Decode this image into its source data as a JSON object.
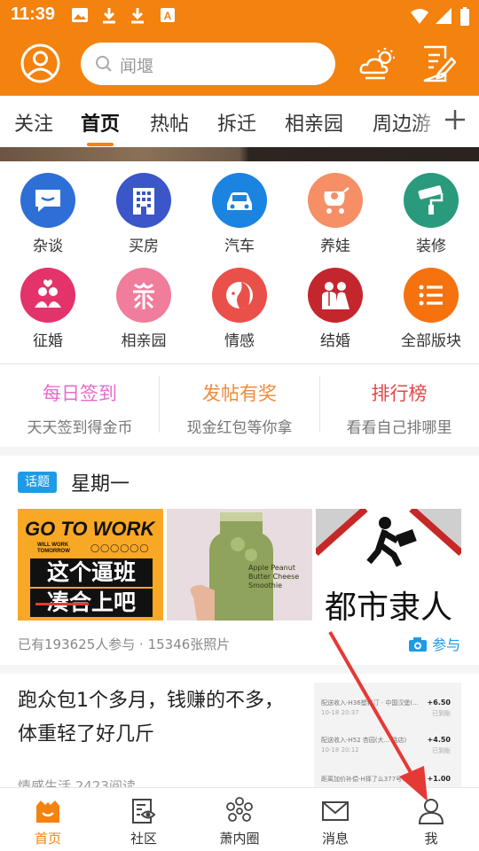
{
  "status_bar": {
    "time": "11:39"
  },
  "header": {
    "search_placeholder": "闻堰",
    "icons": [
      "user-icon",
      "search-icon",
      "weather-icon",
      "edit-icon"
    ]
  },
  "tabs": {
    "items": [
      "关注",
      "首页",
      "热帖",
      "拆迁",
      "相亲园",
      "周边游"
    ],
    "active": "首页"
  },
  "categories": [
    {
      "label": "杂谈",
      "icon": "chat-icon",
      "color": "#2D6FD6"
    },
    {
      "label": "买房",
      "icon": "building-icon",
      "color": "#3B56C9"
    },
    {
      "label": "汽车",
      "icon": "car-icon",
      "color": "#1A84E0"
    },
    {
      "label": "养娃",
      "icon": "stroller-icon",
      "color": "#F68F66"
    },
    {
      "label": "装修",
      "icon": "paint-roller-icon",
      "color": "#2A9A7D"
    },
    {
      "label": "征婚",
      "icon": "couple-icon",
      "color": "#E4336A"
    },
    {
      "label": "相亲园",
      "icon": "marriage-icon",
      "color": "#F07D9B"
    },
    {
      "label": "情感",
      "icon": "face-icon",
      "color": "#E9504A"
    },
    {
      "label": "结婚",
      "icon": "wedding-icon",
      "color": "#C4262E"
    },
    {
      "label": "全部版块",
      "icon": "list-icon",
      "color": "#F6720F"
    }
  ],
  "promos": [
    {
      "title": "每日签到",
      "subtitle": "天天签到得金币",
      "color": "#E86BCB"
    },
    {
      "title": "发帖有奖",
      "subtitle": "现金红包等你拿",
      "color": "#F08A3A"
    },
    {
      "title": "排行榜",
      "subtitle": "看看自己排哪里",
      "color": "#E6454A"
    }
  ],
  "topic": {
    "tag": "话题",
    "title": "星期一",
    "images": [
      {
        "heading": "GO TO WORK",
        "sub": "WILL WORK TOMORROW",
        "line1": "这个逼班",
        "line2": "凑合上吧"
      },
      {
        "bottle_text": "Apple Peanut Butter Cheese Smoothie"
      },
      {
        "caption": "都市隶人"
      }
    ],
    "meta": "已有193625人参与 · 15346张照片",
    "join_label": "参与"
  },
  "article": {
    "title": "跑众包1个多月，钱赚的不多，体重轻了好几斤",
    "meta": "情感生活 2423阅读",
    "thumb_rows": [
      {
        "text": "配送收入-H36塑料汀 · 中国汉堡(...",
        "date": "10-18 20:37",
        "amount": "+6.50",
        "status": "已到账"
      },
      {
        "text": "配送收入-H52 杏园(大... 路店)",
        "date": "10-18 20:12",
        "amount": "+4.50",
        "status": "已到账"
      },
      {
        "text": "距离加价补偿-H择了么377号...",
        "date": "",
        "amount": "+1.00",
        "status": ""
      }
    ]
  },
  "bottom_nav": [
    {
      "label": "首页",
      "icon": "home-icon",
      "active": true
    },
    {
      "label": "社区",
      "icon": "community-icon",
      "active": false
    },
    {
      "label": "萧内圈",
      "icon": "circle-icon",
      "active": false
    },
    {
      "label": "消息",
      "icon": "mail-icon",
      "active": false
    },
    {
      "label": "我",
      "icon": "profile-icon",
      "active": false
    }
  ],
  "colors": {
    "brand": "#F4820E",
    "accent_blue": "#1E9BE6",
    "annotation": "#E53935"
  }
}
